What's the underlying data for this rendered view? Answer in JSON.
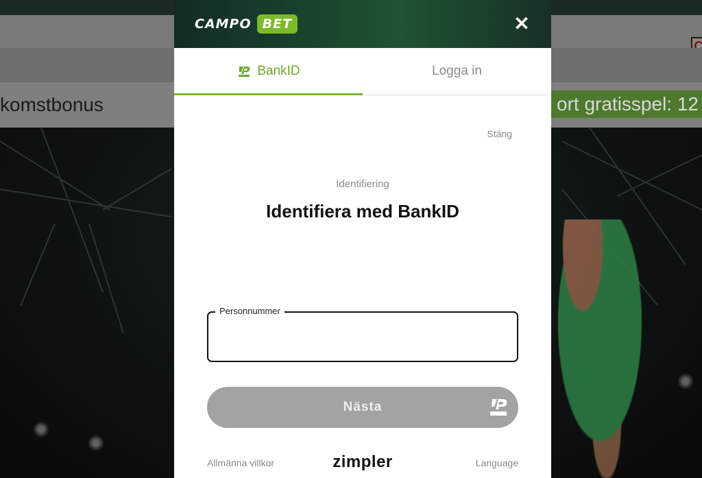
{
  "background": {
    "banner_left_text": "komstbonus",
    "banner_right_text": "ort gratisspel: 12",
    "corner_button_text": "C"
  },
  "modal": {
    "logo": {
      "part1": "CAMPO",
      "part2": "BET"
    },
    "close_icon": "close-icon",
    "tabs": [
      {
        "label": "BankID",
        "active": true,
        "icon": "bankid-icon"
      },
      {
        "label": "Logga in",
        "active": false
      }
    ],
    "close_link": "Stäng",
    "subtitle": "Identifiering",
    "title": "Identifiera med BankID",
    "personnummer": {
      "label": "Personnummer",
      "value": "",
      "placeholder": ""
    },
    "next_button": {
      "label": "Nästa",
      "icon": "bankid-icon"
    },
    "footer": {
      "terms": "Allmänna villkor",
      "brand": "zimpler",
      "language": "Language"
    }
  },
  "colors": {
    "accent_green": "#79b531",
    "header_dark": "#132b25",
    "button_disabled": "#a3a3a3"
  }
}
